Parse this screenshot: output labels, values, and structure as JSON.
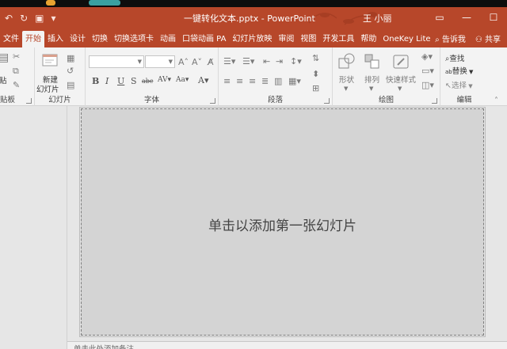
{
  "titlebar": {
    "title": "一键转化文本.pptx  -  PowerPoint",
    "user": "王 小丽",
    "qat_icons": [
      "undo-icon",
      "redo-icon",
      "save-icon",
      "customize-icon"
    ]
  },
  "tabs": [
    "文件",
    "开始",
    "插入",
    "设计",
    "切换",
    "切换选项卡",
    "动画",
    "口袋动画 PA",
    "幻灯片放映",
    "审阅",
    "视图",
    "开发工具",
    "帮助",
    "OneKey Lite"
  ],
  "active_tab": "开始",
  "tell_me": "告诉我",
  "share": "共享",
  "groups": {
    "clipboard": "贴板",
    "slides": "幻灯片",
    "font": "字体",
    "paragraph": "段落",
    "drawing": "绘图",
    "editing": "编辑"
  },
  "buttons": {
    "paste": "贴",
    "new_slide_1": "新建",
    "new_slide_2": "幻灯片",
    "shape": "形状",
    "arrange": "排列",
    "quick_styles": "快速样式",
    "find": "查找",
    "replace": "替换",
    "select": "选择"
  },
  "slide": {
    "placeholder": "单击以添加第一张幻灯片"
  },
  "notes": {
    "placeholder": "单击此处添加备注"
  },
  "colors": {
    "accent": "#b7472a",
    "ribbon_bg": "#f3f3f3",
    "slide_bg": "#d4d4d4"
  }
}
